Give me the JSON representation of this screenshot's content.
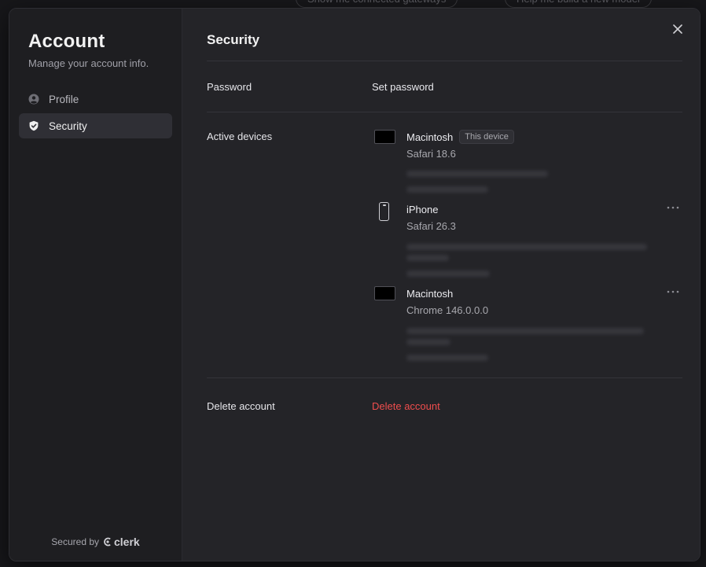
{
  "background": {
    "pill_1": "Show me connected gateways",
    "pill_2": "Help me build a new model"
  },
  "sidebar": {
    "title": "Account",
    "subtitle": "Manage your account info.",
    "items": [
      {
        "label": "Profile",
        "icon": "user-circle-icon",
        "active": false
      },
      {
        "label": "Security",
        "icon": "shield-check-icon",
        "active": true
      }
    ],
    "footer_prefix": "Secured by",
    "footer_brand": "clerk"
  },
  "main": {
    "title": "Security",
    "password": {
      "label": "Password",
      "action": "Set password"
    },
    "devices": {
      "label": "Active devices",
      "items": [
        {
          "type": "laptop",
          "name": "Macintosh",
          "badge": "This device",
          "browser": "Safari 18.6"
        },
        {
          "type": "phone",
          "name": "iPhone",
          "badge": "",
          "browser": "Safari 26.3"
        },
        {
          "type": "laptop",
          "name": "Macintosh",
          "badge": "",
          "browser": "Chrome 146.0.0.0"
        }
      ]
    },
    "delete": {
      "label": "Delete account",
      "action": "Delete account"
    }
  },
  "colors": {
    "danger": "#ef4d4d",
    "active_nav": "#2f2f35",
    "main_bg": "#242428",
    "sidebar_bg": "#1e1e21"
  }
}
